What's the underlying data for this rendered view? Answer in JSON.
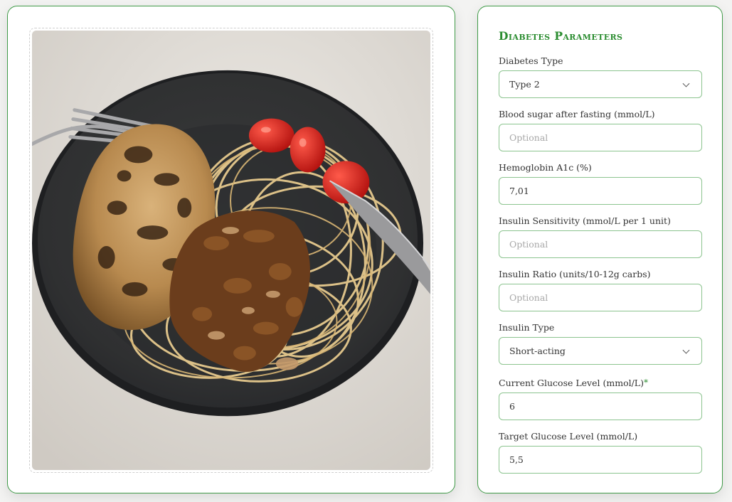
{
  "panel": {
    "title": "Diabetes Parameters",
    "fields": {
      "diabetes_type": {
        "label": "Diabetes Type",
        "value": "Type 2"
      },
      "fasting_sugar": {
        "label": "Blood sugar after fasting (mmol/L)",
        "placeholder": "Optional"
      },
      "hba1c": {
        "label": "Hemoglobin A1c (%)",
        "value": "7,01"
      },
      "insulin_sensitivity": {
        "label": "Insulin Sensitivity (mmol/L per 1 unit)",
        "placeholder": "Optional"
      },
      "insulin_ratio": {
        "label": "Insulin Ratio (units/10-12g carbs)",
        "placeholder": "Optional"
      },
      "insulin_type": {
        "label": "Insulin Type",
        "value": "Short-acting"
      },
      "current_glucose": {
        "label": "Current Glucose Level (mmol/L)",
        "required_mark": "*",
        "value": "6"
      },
      "target_glucose": {
        "label": "Target Glucose Level (mmol/L)",
        "value": "5,5"
      }
    }
  },
  "icons": {
    "select_arrow": "chevron-down-icon"
  },
  "colors": {
    "accent": "#2a8c2f",
    "border": "#8cc48f"
  }
}
